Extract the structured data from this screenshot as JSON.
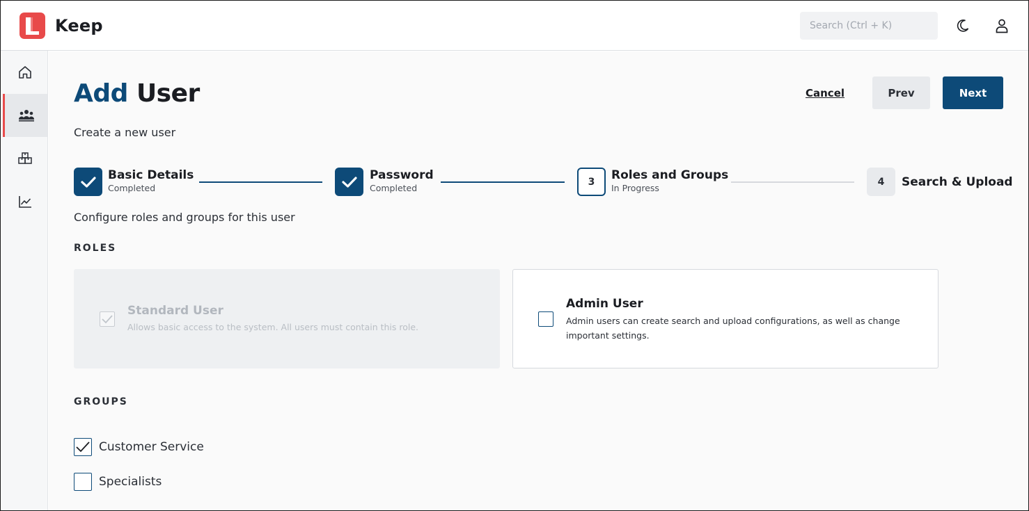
{
  "app": {
    "name": "Keep"
  },
  "header": {
    "search_placeholder": "Search (Ctrl + K)",
    "theme_icon": "moon-icon",
    "user_icon": "user-icon"
  },
  "sidebar": {
    "items": [
      {
        "icon": "home-icon",
        "active": false
      },
      {
        "icon": "users-icon",
        "active": true
      },
      {
        "icon": "boxes-icon",
        "active": false
      },
      {
        "icon": "chart-line-icon",
        "active": false
      }
    ]
  },
  "page": {
    "title_part1": "Add",
    "title_part2": "User",
    "subtitle": "Create a new user",
    "cancel_label": "Cancel",
    "prev_label": "Prev",
    "next_label": "Next"
  },
  "stepper": {
    "steps": [
      {
        "number": "1",
        "label": "Basic Details",
        "status": "Completed"
      },
      {
        "number": "2",
        "label": "Password",
        "status": "Completed"
      },
      {
        "number": "3",
        "label": "Roles and Groups",
        "status": "In Progress"
      },
      {
        "number": "4",
        "label": "Search & Upload",
        "status": ""
      }
    ]
  },
  "form": {
    "description": "Configure roles and groups for this user",
    "roles_heading": "ROLES",
    "roles": [
      {
        "title": "Standard User",
        "description": "Allows basic access to the system. All users must contain this role.",
        "checked": true,
        "disabled": true
      },
      {
        "title": "Admin User",
        "description": "Admin users can create search and upload configurations, as well as change important settings.",
        "checked": false,
        "disabled": false
      }
    ],
    "groups_heading": "GROUPS",
    "groups": [
      {
        "label": "Customer Service",
        "checked": true
      },
      {
        "label": "Specialists",
        "checked": false
      }
    ]
  },
  "colors": {
    "primary": "#0d4a78",
    "brand_red": "#e84a4a"
  }
}
